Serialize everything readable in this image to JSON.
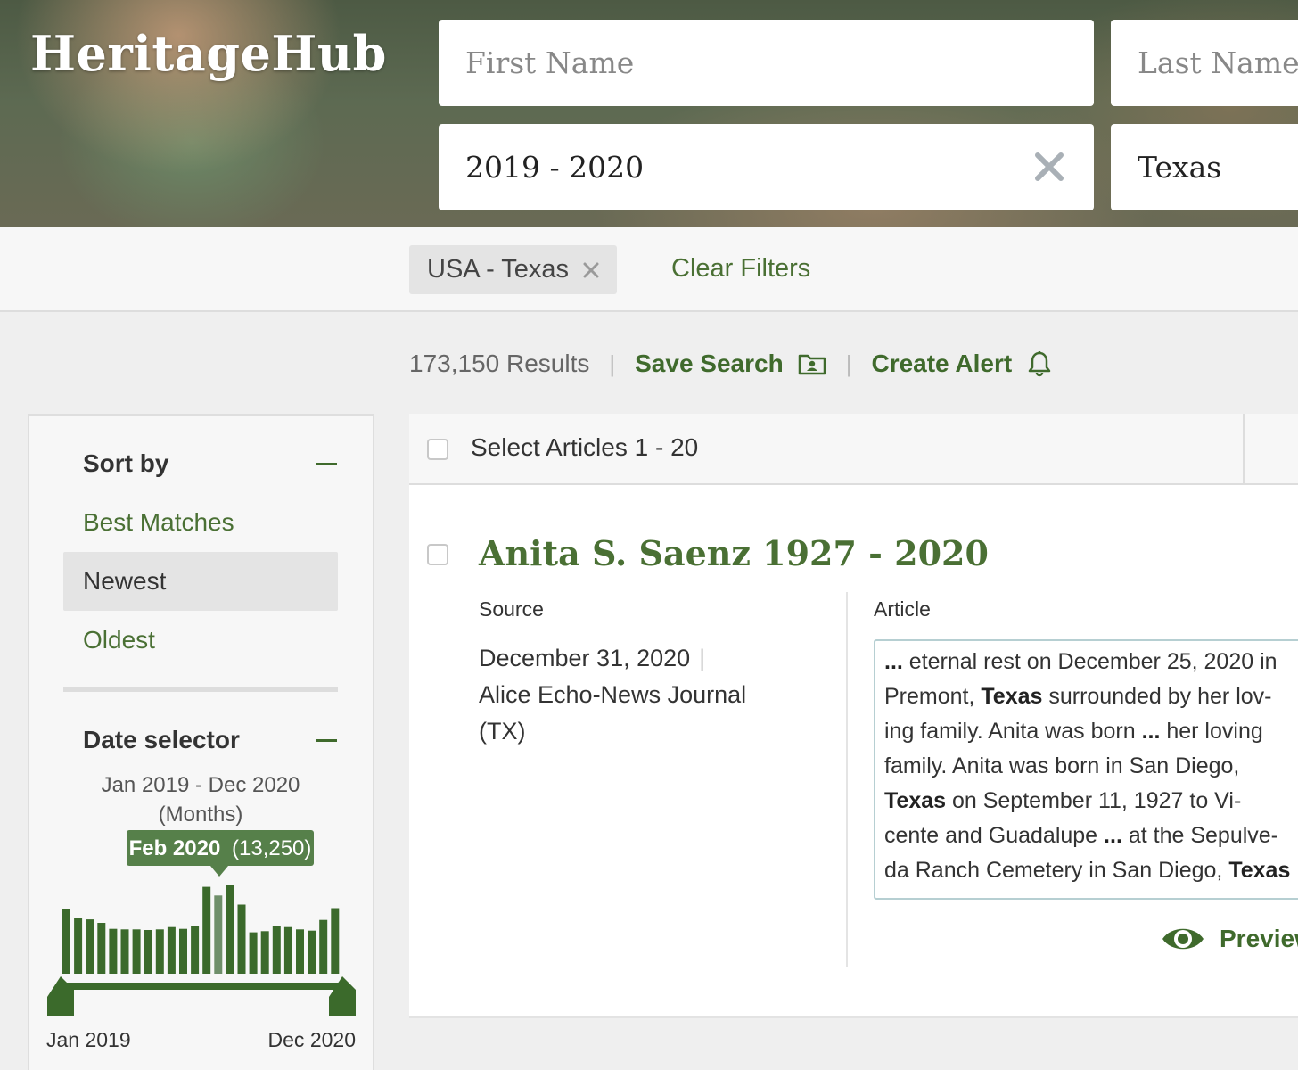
{
  "header": {
    "logo": "HeritageHub",
    "first_name_placeholder": "First Name",
    "last_name_placeholder": "Last Name",
    "years_value": "2019 - 2020",
    "state_value": "Texas"
  },
  "filters": {
    "chip_label": "USA - Texas",
    "clear_filters": "Clear Filters"
  },
  "results_bar": {
    "count": "173,150 Results",
    "save_search": "Save Search",
    "create_alert": "Create Alert"
  },
  "sidebar": {
    "sort_title": "Sort by",
    "sort_options": [
      "Best Matches",
      "Newest",
      "Oldest"
    ],
    "sort_selected": "Newest",
    "date_title": "Date selector",
    "date_range": "Jan 2019 - Dec 2020",
    "date_unit": "(Months)",
    "histogram": {
      "tooltip_month": "Feb 2020",
      "tooltip_count": "(13,250)",
      "highlight_index": 13,
      "values": [
        11000,
        9400,
        9200,
        8600,
        7600,
        7500,
        7500,
        7400,
        7500,
        7900,
        7600,
        8100,
        14700,
        13250,
        15100,
        11700,
        7000,
        7200,
        8000,
        7900,
        7500,
        7300,
        9100,
        11100
      ],
      "range_start": "Jan 2019",
      "range_end": "Dec 2020"
    }
  },
  "list": {
    "select_label": "Select Articles 1 - 20"
  },
  "result": {
    "title": "Anita S. Saenz 1927 - 2020",
    "source_label": "Source",
    "article_label": "Article",
    "date": "December 31, 2020",
    "publication": "Alice Echo-News Journal (TX)",
    "article_lines": [
      [
        {
          "t": "...",
          "b": true
        },
        {
          "t": " eternal rest on December 25, 2020 in",
          "b": false
        }
      ],
      [
        {
          "t": "Premont, ",
          "b": false
        },
        {
          "t": "Texas",
          "b": true
        },
        {
          "t": " surrounded by her lov-",
          "b": false
        }
      ],
      [
        {
          "t": "ing family. Anita was born ",
          "b": false
        },
        {
          "t": "...",
          "b": true
        },
        {
          "t": " her loving",
          "b": false
        }
      ],
      [
        {
          "t": "family. Anita was born in San Diego,",
          "b": false
        }
      ],
      [
        {
          "t": "Texas",
          "b": true
        },
        {
          "t": " on September 11, 1927 to Vi-",
          "b": false
        }
      ],
      [
        {
          "t": "cente and Guadalupe ",
          "b": false
        },
        {
          "t": "...",
          "b": true
        },
        {
          "t": " at the Sepulve-",
          "b": false
        }
      ],
      [
        {
          "t": "da Ranch Cemetery in San Diego, ",
          "b": false
        },
        {
          "t": "Texas",
          "b": true
        }
      ]
    ],
    "preview": "Preview"
  },
  "colors": {
    "brand_green": "#3f6a2c",
    "bar_green": "#3b6a2b",
    "bar_highlight": "#6f8f6a",
    "box_border": "#b6cfd2"
  }
}
